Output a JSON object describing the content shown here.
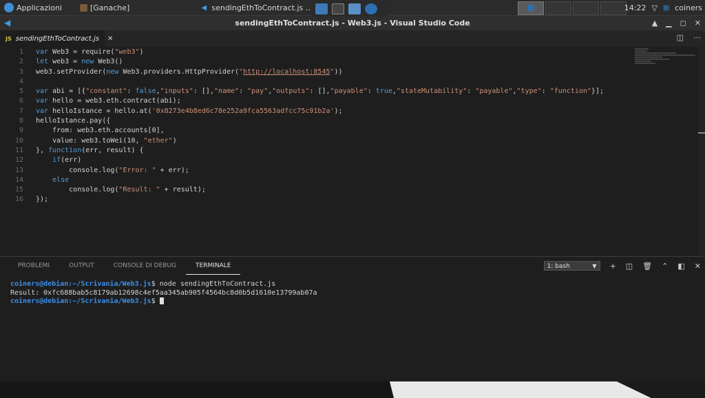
{
  "system_panel": {
    "apps_menu": "Applicazioni",
    "task1": "[Ganache]",
    "task2": "sendingEthToContract.js ...",
    "clock": "14:22",
    "user": "coiners"
  },
  "window": {
    "title": "sendingEthToContract.js - Web3.js - Visual Studio Code"
  },
  "editor": {
    "tab_label": "sendingEthToContract.js",
    "tab_lang": "JS",
    "line_numbers": [
      "1",
      "2",
      "3",
      "4",
      "5",
      "6",
      "7",
      "8",
      "9",
      "10",
      "11",
      "12",
      "13",
      "14",
      "15",
      "16"
    ]
  },
  "code": {
    "l1": [
      "var",
      " Web3 = require(",
      "\"web3\"",
      ")"
    ],
    "l2": [
      "let",
      " web3 = ",
      "new",
      " Web3()"
    ],
    "l3": [
      "web3.setProvider(",
      "new",
      " Web3.providers.HttpProvider(",
      "\"",
      "http://localhost:8545",
      "\"",
      "))"
    ],
    "l5": [
      "var",
      " abi = [{",
      "\"constant\"",
      ": ",
      "false",
      ",",
      "\"inputs\"",
      ": [],",
      "\"name\"",
      ": ",
      "\"pay\"",
      ",",
      "\"outputs\"",
      ": [],",
      "\"payable\"",
      ": ",
      "true",
      ",",
      "\"stateMutability\"",
      ": ",
      "\"payable\"",
      ",",
      "\"type\"",
      ": ",
      "\"function\"",
      "}];"
    ],
    "l6": [
      "var",
      " hello = web3.eth.contract(abi);"
    ],
    "l7": [
      "var",
      " helloIstance = hello.at(",
      "'0x8273e4b8ed6c78e252a9fca5563adfcc75c91b2a'",
      ");"
    ],
    "l8": [
      "helloIstance.pay({"
    ],
    "l9": [
      "    from: web3.eth.accounts[0],"
    ],
    "l10": [
      "    value: web3.toWei(10, ",
      "\"ether\"",
      ")"
    ],
    "l11": [
      "}, ",
      "function",
      "(err, result) {"
    ],
    "l12": [
      "    ",
      "if",
      "(err)"
    ],
    "l13": [
      "        console.log(",
      "\"Error: \"",
      " + err);"
    ],
    "l14": [
      "    ",
      "else"
    ],
    "l15": [
      "        console.log(",
      "\"Result: \"",
      " + result);"
    ],
    "l16": [
      "});"
    ]
  },
  "panel": {
    "tabs": [
      "PROBLEMI",
      "OUTPUT",
      "CONSOLE DI DEBUG",
      "TERMINALE"
    ],
    "shell_select": "1: bash",
    "terminal": {
      "prompt": "coiners@debian:~/Scrivania/Web3.js",
      "cmd1": "$ node sendingEthToContract.js",
      "output": "Result: 0xfc688bab5c8179ab12698c4ef5aa345ab905f4564bc8d0b5d1610e13799ab07a",
      "cmd2": "$ "
    }
  },
  "colors": {
    "keyword": "#569cd6",
    "string": "#ce9178",
    "prompt": "#3b8eea"
  }
}
